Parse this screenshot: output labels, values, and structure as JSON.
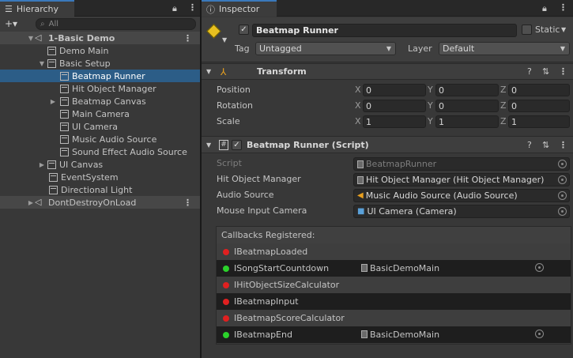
{
  "hierarchy": {
    "tab_label": "Hierarchy",
    "add_label": "+▾",
    "search_placeholder": "All",
    "items": [
      {
        "label": "1-Basic Demo"
      },
      {
        "label": "Demo Main"
      },
      {
        "label": "Basic Setup"
      },
      {
        "label": "Beatmap Runner"
      },
      {
        "label": "Hit Object Manager"
      },
      {
        "label": "Beatmap Canvas"
      },
      {
        "label": "Main Camera"
      },
      {
        "label": "UI Camera"
      },
      {
        "label": "Music Audio Source"
      },
      {
        "label": "Sound Effect Audio Source"
      },
      {
        "label": "UI Canvas"
      },
      {
        "label": "EventSystem"
      },
      {
        "label": "Directional Light"
      },
      {
        "label": "DontDestroyOnLoad"
      }
    ]
  },
  "inspector": {
    "tab_label": "Inspector",
    "object_name": "Beatmap Runner",
    "static_label": "Static",
    "tag_label": "Tag",
    "tag_value": "Untagged",
    "layer_label": "Layer",
    "layer_value": "Default",
    "transform": {
      "title": "Transform",
      "position_label": "Position",
      "rotation_label": "Rotation",
      "scale_label": "Scale",
      "x": "X",
      "y": "Y",
      "z": "Z",
      "position": [
        "0",
        "0",
        "0"
      ],
      "rotation": [
        "0",
        "0",
        "0"
      ],
      "scale": [
        "1",
        "1",
        "1"
      ]
    },
    "script_component": {
      "title": "Beatmap Runner (Script)",
      "script_label": "Script",
      "script_value": "BeatmapRunner",
      "hit_object_label": "Hit Object Manager",
      "hit_object_value": "Hit Object Manager (Hit Object Manager)",
      "audio_label": "Audio Source",
      "audio_value": "Music Audio Source (Audio Source)",
      "camera_label": "Mouse Input Camera",
      "camera_value": "UI Camera (Camera)",
      "callbacks_title": "Callbacks Registered:",
      "callbacks": [
        {
          "name": "IBeatmapLoaded",
          "status": "red",
          "target": ""
        },
        {
          "name": "ISongStartCountdown",
          "status": "green",
          "target": "BasicDemoMain"
        },
        {
          "name": "IHitObjectSizeCalculator",
          "status": "red",
          "target": ""
        },
        {
          "name": "IBeatmapInput",
          "status": "red",
          "target": ""
        },
        {
          "name": "IBeatmapScoreCalculator",
          "status": "red",
          "target": ""
        },
        {
          "name": "IBeatmapEnd",
          "status": "green",
          "target": "BasicDemoMain"
        }
      ]
    }
  },
  "colors": {
    "selection": "#2c5d87",
    "green": "#2bd22b",
    "red": "#e02020"
  }
}
